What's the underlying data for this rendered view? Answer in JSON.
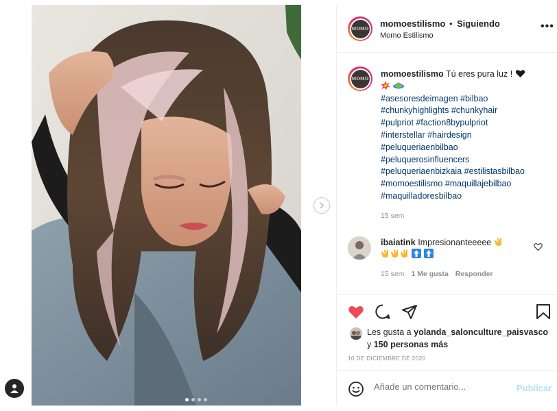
{
  "post": {
    "username": "momoestilismo",
    "separator": "•",
    "follow_state": "Siguiendo",
    "subtitle": "Momo Estilismo",
    "more": "•••",
    "avatar_text": "MOMO"
  },
  "caption": {
    "username": "momoestilismo",
    "text": "Tú eres pura luz !",
    "hashtag_lines": [
      "#asesoresdeimagen #bilbao",
      "#chunkyhighlights #chunkyhair",
      "#pulpriot #faction8bypulpriot",
      "#interstellar #hairdesign",
      "#peluqueriaenbilbao",
      "#peluquerosinfluencers",
      "#peluqueriaenbizkaia #estilistasbilbao",
      "#momoestilismo #maquillajebilbao",
      "#maquilladoresbilbao"
    ],
    "time": "15 sem"
  },
  "comment": {
    "username": "ibaiatink",
    "text": "Impresionanteeeee",
    "time": "15 sem",
    "likes": "1 Me gusta",
    "reply": "Responder"
  },
  "likes": {
    "prefix": "Les gusta a",
    "user": "yolanda_salonculture_paisvasco",
    "connector": "y",
    "others": "150 personas más"
  },
  "date": "10 DE DICIEMBRE DE 2020",
  "comment_box": {
    "placeholder": "Añade un comentario...",
    "publish": "Publicar"
  },
  "colors": {
    "hashtag": "#00376b",
    "like_red": "#ed4956",
    "publish_disabled": "#b2dffc",
    "muted": "#8e8e8e"
  },
  "carousel": {
    "count": 4,
    "active_index": 1
  }
}
